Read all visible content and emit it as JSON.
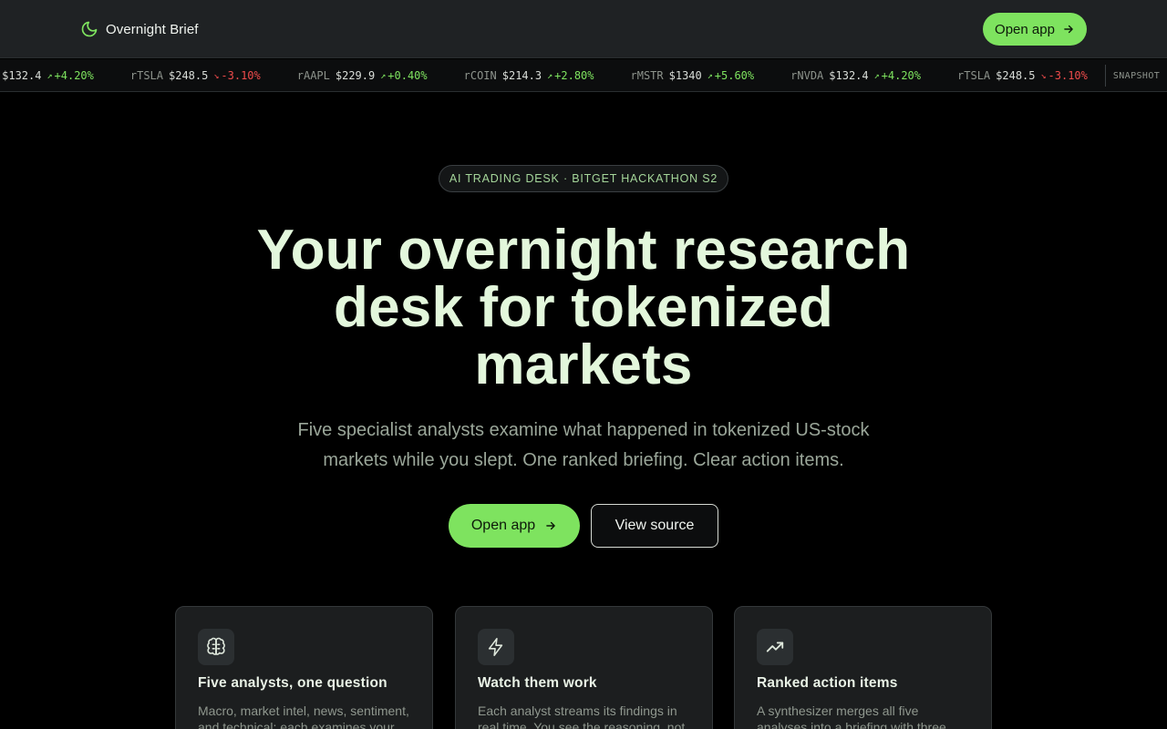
{
  "header": {
    "brand": "Overnight Brief",
    "open_app": "Open app"
  },
  "ticker": {
    "items": [
      {
        "symbol": "rNVDA",
        "price": "$132.4",
        "change": "+4.20%",
        "direction": "up"
      },
      {
        "symbol": "rTSLA",
        "price": "$248.5",
        "change": "-3.10%",
        "direction": "down"
      },
      {
        "symbol": "rAAPL",
        "price": "$229.9",
        "change": "+0.40%",
        "direction": "up"
      },
      {
        "symbol": "rCOIN",
        "price": "$214.3",
        "change": "+2.80%",
        "direction": "up"
      },
      {
        "symbol": "rMSTR",
        "price": "$1340",
        "change": "+5.60%",
        "direction": "up"
      },
      {
        "symbol": "rNVDA",
        "price": "$132.4",
        "change": "+4.20%",
        "direction": "up"
      },
      {
        "symbol": "rTSLA",
        "price": "$248.5",
        "change": "-3.10%",
        "direction": "down"
      }
    ],
    "snapshot_label": "SNAPSHOT"
  },
  "hero": {
    "badge": "AI TRADING DESK · BITGET HACKATHON S2",
    "title_line1": "Your overnight research",
    "title_line2": "desk for tokenized",
    "title_line3": "markets",
    "subtitle_line1": "Five specialist analysts examine what happened in tokenized US-stock",
    "subtitle_line2": "markets while you slept. One ranked briefing. Clear action items.",
    "primary_cta": "Open app",
    "secondary_cta": "View source"
  },
  "features": [
    {
      "icon": "brain-icon",
      "title": "Five analysts, one question",
      "desc": "Macro, market intel, news, sentiment, and technical: each examines your"
    },
    {
      "icon": "zap-icon",
      "title": "Watch them work",
      "desc": "Each analyst streams its findings in real time. You see the reasoning, not"
    },
    {
      "icon": "trending-up-icon",
      "title": "Ranked action items",
      "desc": "A synthesizer merges all five analyses into a briefing with three"
    }
  ],
  "colors": {
    "accent": "#7ee35f",
    "up": "#7ee35f",
    "down": "#ef4b4b",
    "header_bg": "#1f2224",
    "page_bg": "#000000"
  }
}
